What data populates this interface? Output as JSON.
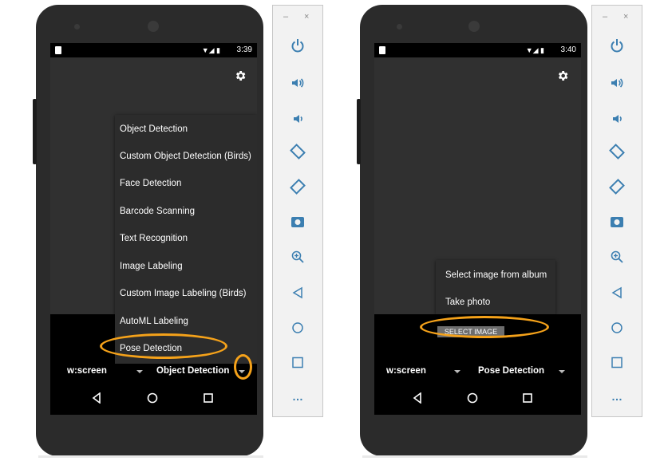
{
  "left": {
    "status_time": "3:39",
    "menu_items": [
      "Object Detection",
      "Custom Object Detection (Birds)",
      "Face Detection",
      "Barcode Scanning",
      "Text Recognition",
      "Image Labeling",
      "Custom Image Labeling (Birds)",
      "AutoML Labeling",
      "Pose Detection"
    ],
    "size_spinner": "w:screen",
    "mode_spinner": "Object Detection"
  },
  "right": {
    "status_time": "3:40",
    "popup_items": [
      "Select image from album",
      "Take photo"
    ],
    "select_button": "SELECT IMAGE",
    "size_spinner": "w:screen",
    "mode_spinner": "Pose Detection"
  },
  "toolbar": {
    "minimize": "–",
    "close": "×",
    "more": "…"
  },
  "accent_color": "#f5a21a"
}
